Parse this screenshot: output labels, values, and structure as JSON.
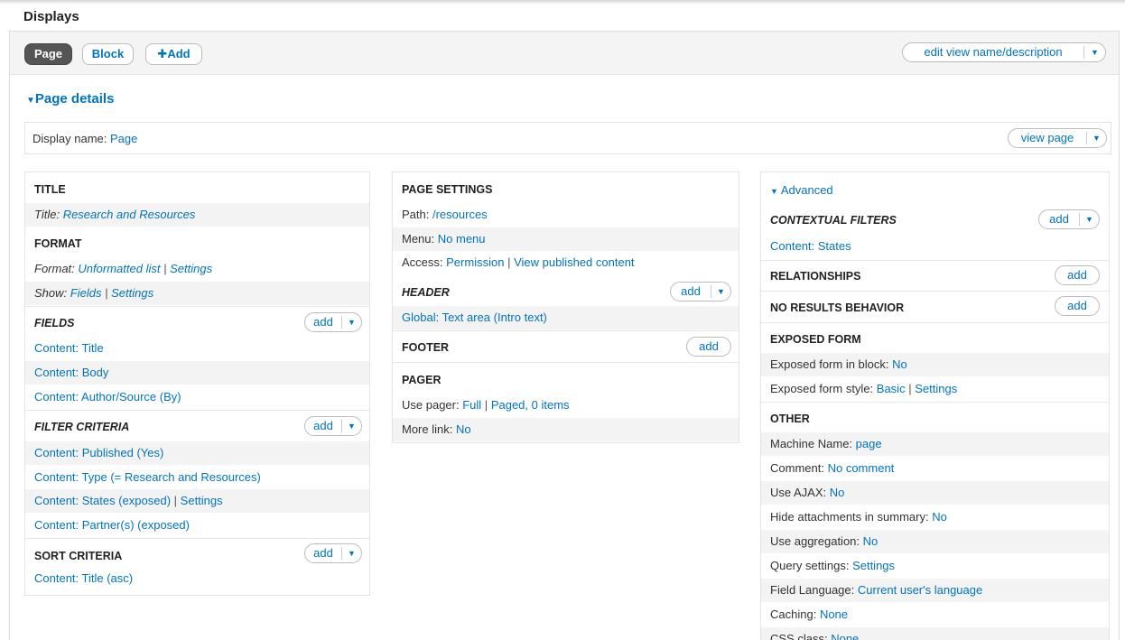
{
  "displays_title": "Displays",
  "tabs": [
    "Page",
    "Block"
  ],
  "add_display": "Add",
  "edit_view": "edit view name/description",
  "page_details": "Page details",
  "display_name_label": "Display name:",
  "display_name_value": "Page",
  "view_page": "view page",
  "add_label": "add",
  "col1": {
    "title_header": "TITLE",
    "title_label": "Title:",
    "title_value": "Research and Resources",
    "format_header": "FORMAT",
    "format_label": "Format:",
    "format_value": "Unformatted list",
    "format_settings": "Settings",
    "show_label": "Show:",
    "show_value": "Fields",
    "show_settings": "Settings",
    "fields_header": "FIELDS",
    "fields": [
      "Content: Title",
      "Content: Body",
      "Content: Author/Source (By)"
    ],
    "filter_header": "FILTER CRITERIA",
    "filters": [
      "Content: Published (Yes)",
      "Content: Type (= Research and Resources)",
      "Content: States (exposed)",
      "Content: Partner(s) (exposed)"
    ],
    "filter_settings": "Settings",
    "sort_header": "SORT CRITERIA",
    "sorts": [
      "Content: Title (asc)"
    ]
  },
  "col2": {
    "page_settings_header": "PAGE SETTINGS",
    "path_label": "Path:",
    "path_value": "/resources",
    "menu_label": "Menu:",
    "menu_value": "No menu",
    "access_label": "Access:",
    "access_value": "Permission",
    "access_value2": "View published content",
    "header_header": "HEADER",
    "header_item": "Global: Text area (Intro text)",
    "footer_header": "FOOTER",
    "pager_header": "PAGER",
    "pager_label": "Use pager:",
    "pager_value": "Full",
    "pager_value2": "Paged, 0 items",
    "more_label": "More link:",
    "more_value": "No"
  },
  "col3": {
    "advanced": "Advanced",
    "contextual_header": "CONTEXTUAL FILTERS",
    "contextual_item": "Content: States",
    "relationships_header": "RELATIONSHIPS",
    "noresults_header": "NO RESULTS BEHAVIOR",
    "exposed_header": "EXPOSED FORM",
    "exposed_block_label": "Exposed form in block:",
    "exposed_block_value": "No",
    "exposed_style_label": "Exposed form style:",
    "exposed_style_value": "Basic",
    "exposed_style_settings": "Settings",
    "other_header": "OTHER",
    "other": [
      {
        "label": "Machine Name:",
        "value": "page"
      },
      {
        "label": "Comment:",
        "value": "No comment"
      },
      {
        "label": "Use AJAX:",
        "value": "No"
      },
      {
        "label": "Hide attachments in summary:",
        "value": "No"
      },
      {
        "label": "Use aggregation:",
        "value": "No"
      },
      {
        "label": "Query settings:",
        "value": "Settings"
      },
      {
        "label": "Field Language:",
        "value": "Current user's language"
      },
      {
        "label": "Caching:",
        "value": "None"
      },
      {
        "label": "CSS class:",
        "value": "None"
      }
    ]
  }
}
